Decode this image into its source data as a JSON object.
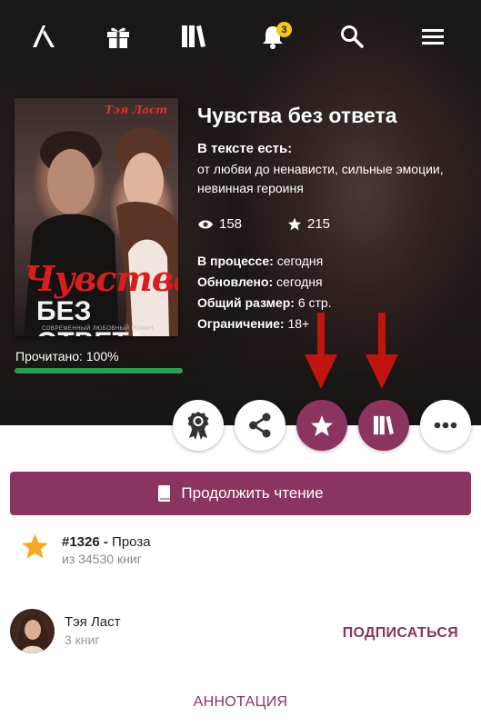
{
  "nav": {
    "logo": "litnet-logo",
    "icons": [
      "gift-icon",
      "library-icon",
      "bell-icon",
      "search-icon",
      "menu-icon"
    ],
    "notifications_count": "3"
  },
  "book": {
    "title": "Чувства без ответа",
    "tags_heading": "В тексте есть:",
    "tags": "от любви до ненависти, сильные эмоции, невинная героиня",
    "views": "158",
    "likes": "215",
    "status_label": "В процессе:",
    "status_value": "сегодня",
    "updated_label": "Обновлено:",
    "updated_value": "сегодня",
    "size_label": "Общий размер:",
    "size_value": "6 стр.",
    "restriction_label": "Ограничение:",
    "restriction_value": "18+"
  },
  "cover": {
    "author": "Тэя Ласт",
    "title_line1": "Чувства",
    "title_line2": "БЕЗ ОТВЕТА",
    "subtitle": "СОВРЕМЕННЫЙ ЛЮБОВНЫЙ РОМАН"
  },
  "progress": {
    "label": "Прочитано: 100%",
    "fraction": 1.0
  },
  "actions": [
    "award-icon",
    "share-icon",
    "star-icon",
    "library-icon",
    "more-icon"
  ],
  "continue_label": "Продолжить чтение",
  "rank": {
    "position": "#1326 -",
    "genre": "Проза",
    "sub": "из 34530 книг"
  },
  "author": {
    "name": "Тэя Ласт",
    "books": "3 книг",
    "subscribe_label": "ПОДПИСАТЬСЯ"
  },
  "annotation_label": "АННОТАЦИЯ",
  "colors": {
    "accent": "#8b3460",
    "progress": "#2e9a5a",
    "rank_star": "#f5a623",
    "arrow": "#c0150f",
    "badge": "#f5c518"
  }
}
